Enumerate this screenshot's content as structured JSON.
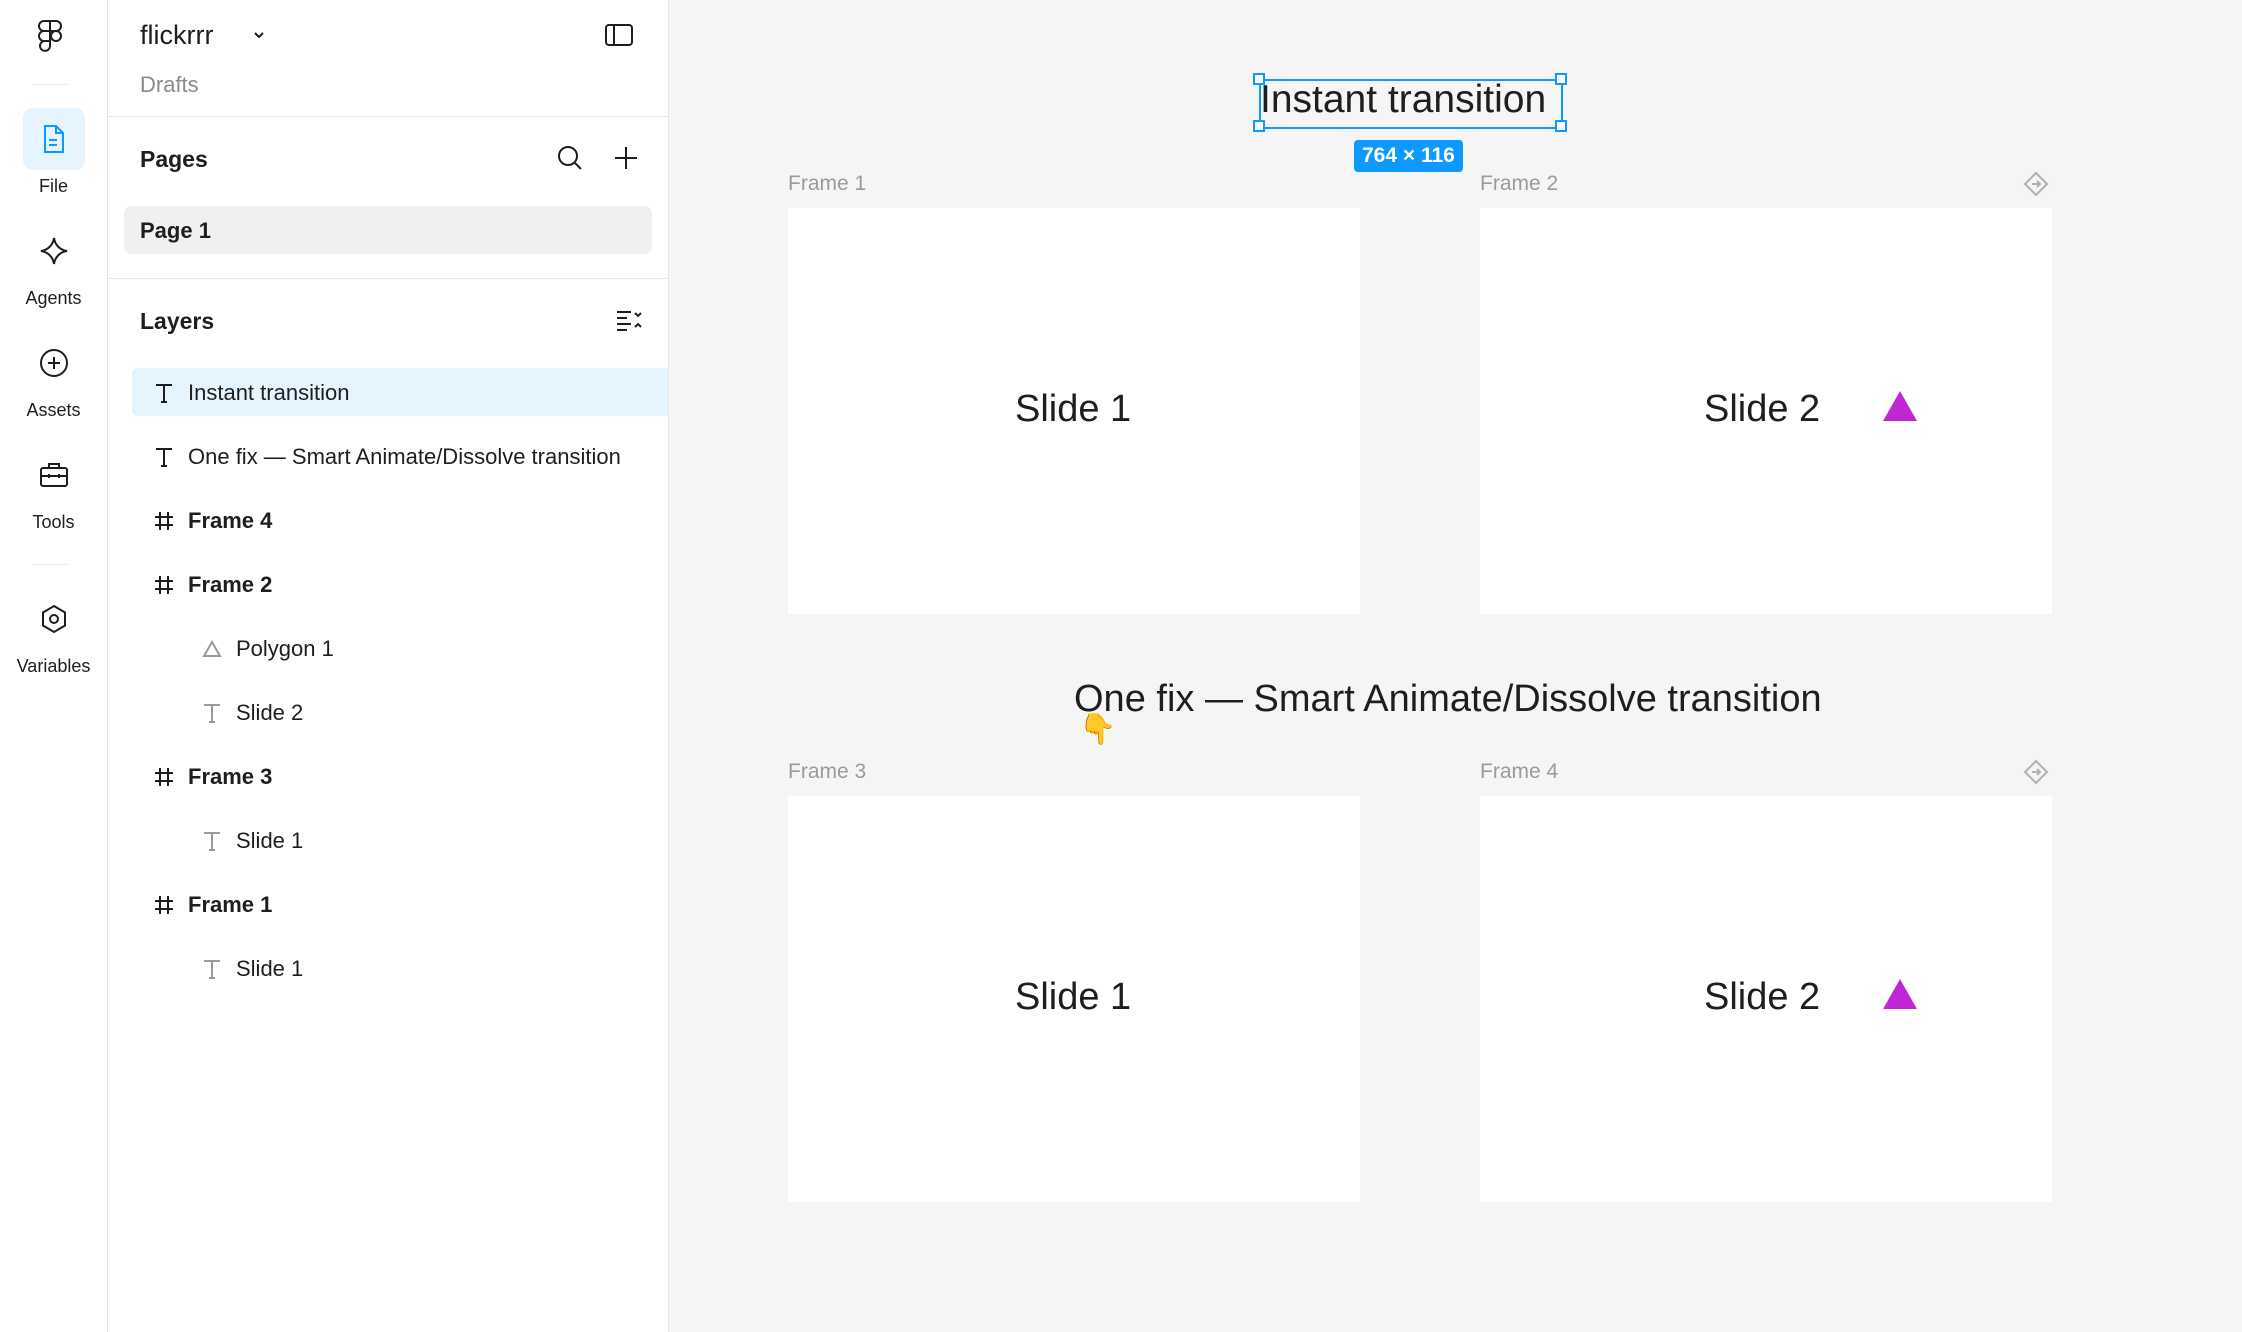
{
  "rail": {
    "items": [
      {
        "label": "File"
      },
      {
        "label": "Agents"
      },
      {
        "label": "Assets"
      },
      {
        "label": "Tools"
      },
      {
        "label": "Variables"
      }
    ]
  },
  "file": {
    "name": "flickrrr",
    "location": "Drafts"
  },
  "pages": {
    "title": "Pages",
    "items": [
      "Page 1"
    ]
  },
  "layers": {
    "title": "Layers",
    "items": [
      {
        "label": "Instant transition",
        "type": "text"
      },
      {
        "label": "One fix — Smart Animate/Dissolve transition",
        "type": "text"
      },
      {
        "label": "Frame 4",
        "type": "frame"
      },
      {
        "label": "Frame 2",
        "type": "frame"
      },
      {
        "label": "Polygon 1",
        "type": "polygon"
      },
      {
        "label": "Slide 2",
        "type": "text"
      },
      {
        "label": "Frame 3",
        "type": "frame"
      },
      {
        "label": "Slide 1",
        "type": "text"
      },
      {
        "label": "Frame 1",
        "type": "frame"
      },
      {
        "label": "Slide 1",
        "type": "text"
      }
    ]
  },
  "canvas": {
    "selected_text": "Instant transition",
    "selection_size": "764 × 116",
    "second_text": "One fix — Smart Animate/Dissolve transition",
    "frames": [
      {
        "label": "Frame 1",
        "text": "Slide 1"
      },
      {
        "label": "Frame 2",
        "text": "Slide 2"
      },
      {
        "label": "Frame 3",
        "text": "Slide 1"
      },
      {
        "label": "Frame 4",
        "text": "Slide 2"
      }
    ],
    "cursor": "👇"
  },
  "colors": {
    "accent": "#0d99ff",
    "polygon": "#c026d3",
    "selection_bg": "#e5f4ff"
  }
}
